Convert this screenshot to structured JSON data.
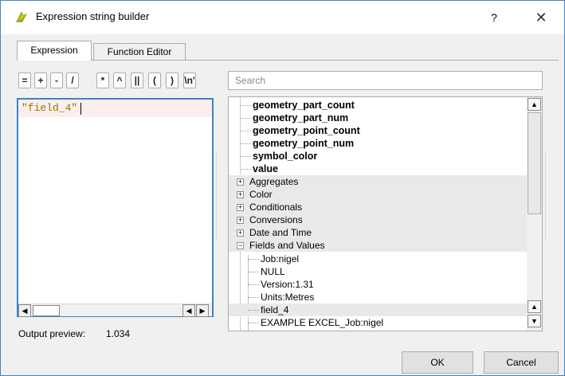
{
  "window": {
    "title": "Expression string builder",
    "help_label": "?",
    "close_label": "✕"
  },
  "tabs": [
    {
      "label": "Expression",
      "active": true
    },
    {
      "label": "Function Editor",
      "active": false
    }
  ],
  "operators": [
    "=",
    "+",
    "-",
    "/",
    "*",
    "^",
    "||",
    "(",
    ")",
    "\\n'"
  ],
  "editor": {
    "value": "\"field_4\""
  },
  "preview": {
    "label": "Output preview:",
    "value": "1.034"
  },
  "search": {
    "placeholder": "Search"
  },
  "tree": {
    "bold_items": [
      "geometry_part_count",
      "geometry_part_num",
      "geometry_point_count",
      "geometry_point_num",
      "symbol_color",
      "value"
    ],
    "groups": [
      "Aggregates",
      "Color",
      "Conditionals",
      "Conversions",
      "Date and Time",
      "Fields and Values"
    ],
    "field_values": [
      "Job:nigel",
      "NULL",
      "Version:1.31",
      "Units:Metres",
      "field_4",
      "EXAMPLE EXCEL_Job:nigel"
    ]
  },
  "buttons": {
    "ok": "OK",
    "cancel": "Cancel"
  },
  "colors": {
    "accent": "#3c84c9",
    "expression_text": "#8a7a00",
    "current_line": "#fdeeee"
  }
}
